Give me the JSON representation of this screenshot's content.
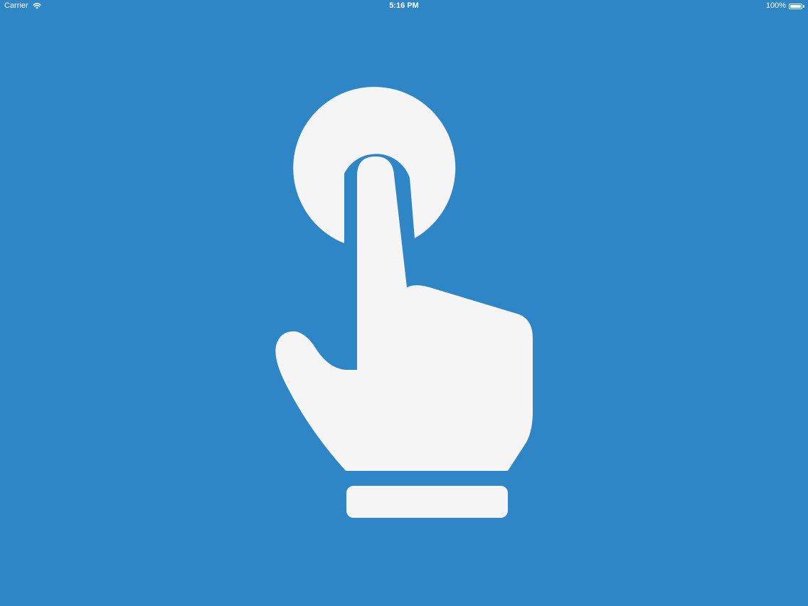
{
  "status_bar": {
    "carrier": "Carrier",
    "time": "5:16 PM",
    "battery_percent_label": "100%",
    "battery_level": 1.0
  },
  "main": {
    "icon": "tap-gesture-icon",
    "background_color": "#2f86c6",
    "icon_color": "#f5f5f5"
  }
}
